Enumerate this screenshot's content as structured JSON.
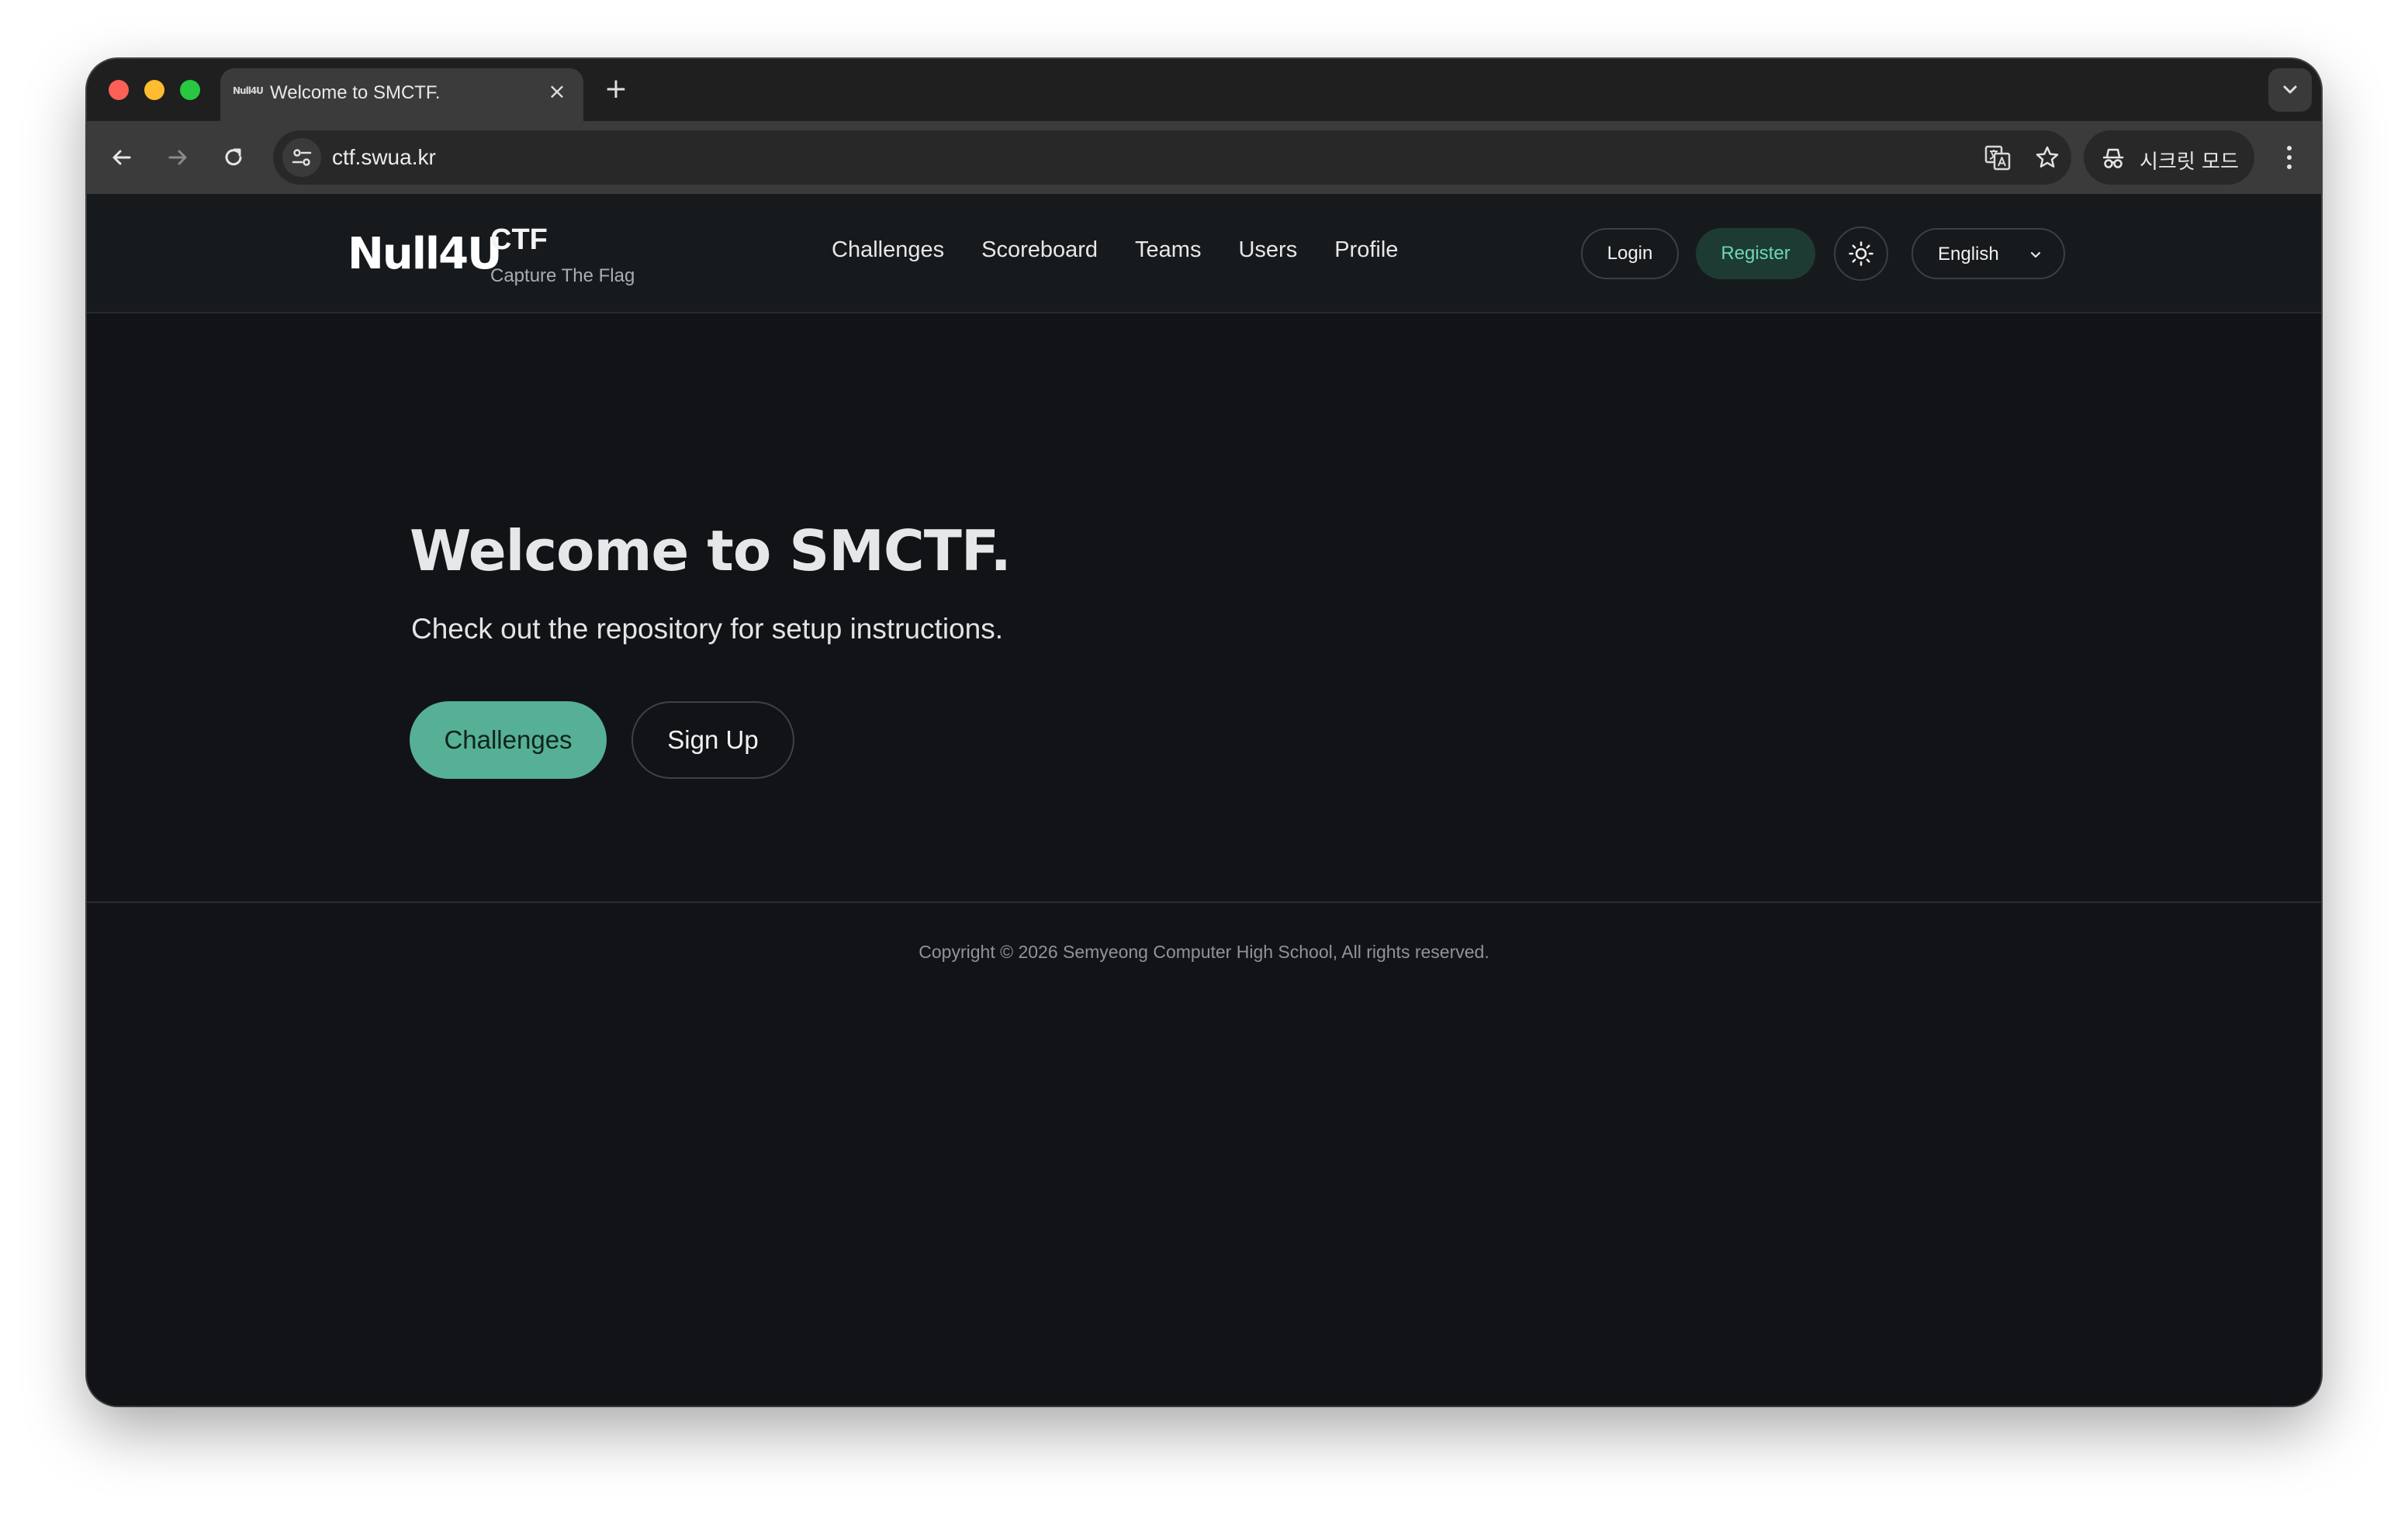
{
  "browser": {
    "tab": {
      "favicon_text": "Null4U",
      "title": "Welcome to SMCTF."
    },
    "address_bar": {
      "url": "ctf.swua.kr"
    },
    "incognito_label": "시크릿 모드"
  },
  "site": {
    "logo_text": "Null4U",
    "brand": {
      "title": "CTF",
      "subtitle": "Capture The Flag"
    },
    "nav": [
      {
        "label": "Challenges"
      },
      {
        "label": "Scoreboard"
      },
      {
        "label": "Teams"
      },
      {
        "label": "Users"
      },
      {
        "label": "Profile"
      }
    ],
    "actions": {
      "login": "Login",
      "register": "Register",
      "language": "English"
    },
    "hero": {
      "title": "Welcome to SMCTF.",
      "subtitle": "Check out the repository for setup instructions.",
      "primary_button": "Challenges",
      "secondary_button": "Sign Up"
    },
    "footer": {
      "copyright": "Copyright © 2026 Semyeong Computer High School, All rights reserved."
    }
  },
  "colors": {
    "accent": "#56b096",
    "register_bg": "#1d3b33",
    "register_text": "#6fd6b4",
    "page_bg": "#121317"
  }
}
